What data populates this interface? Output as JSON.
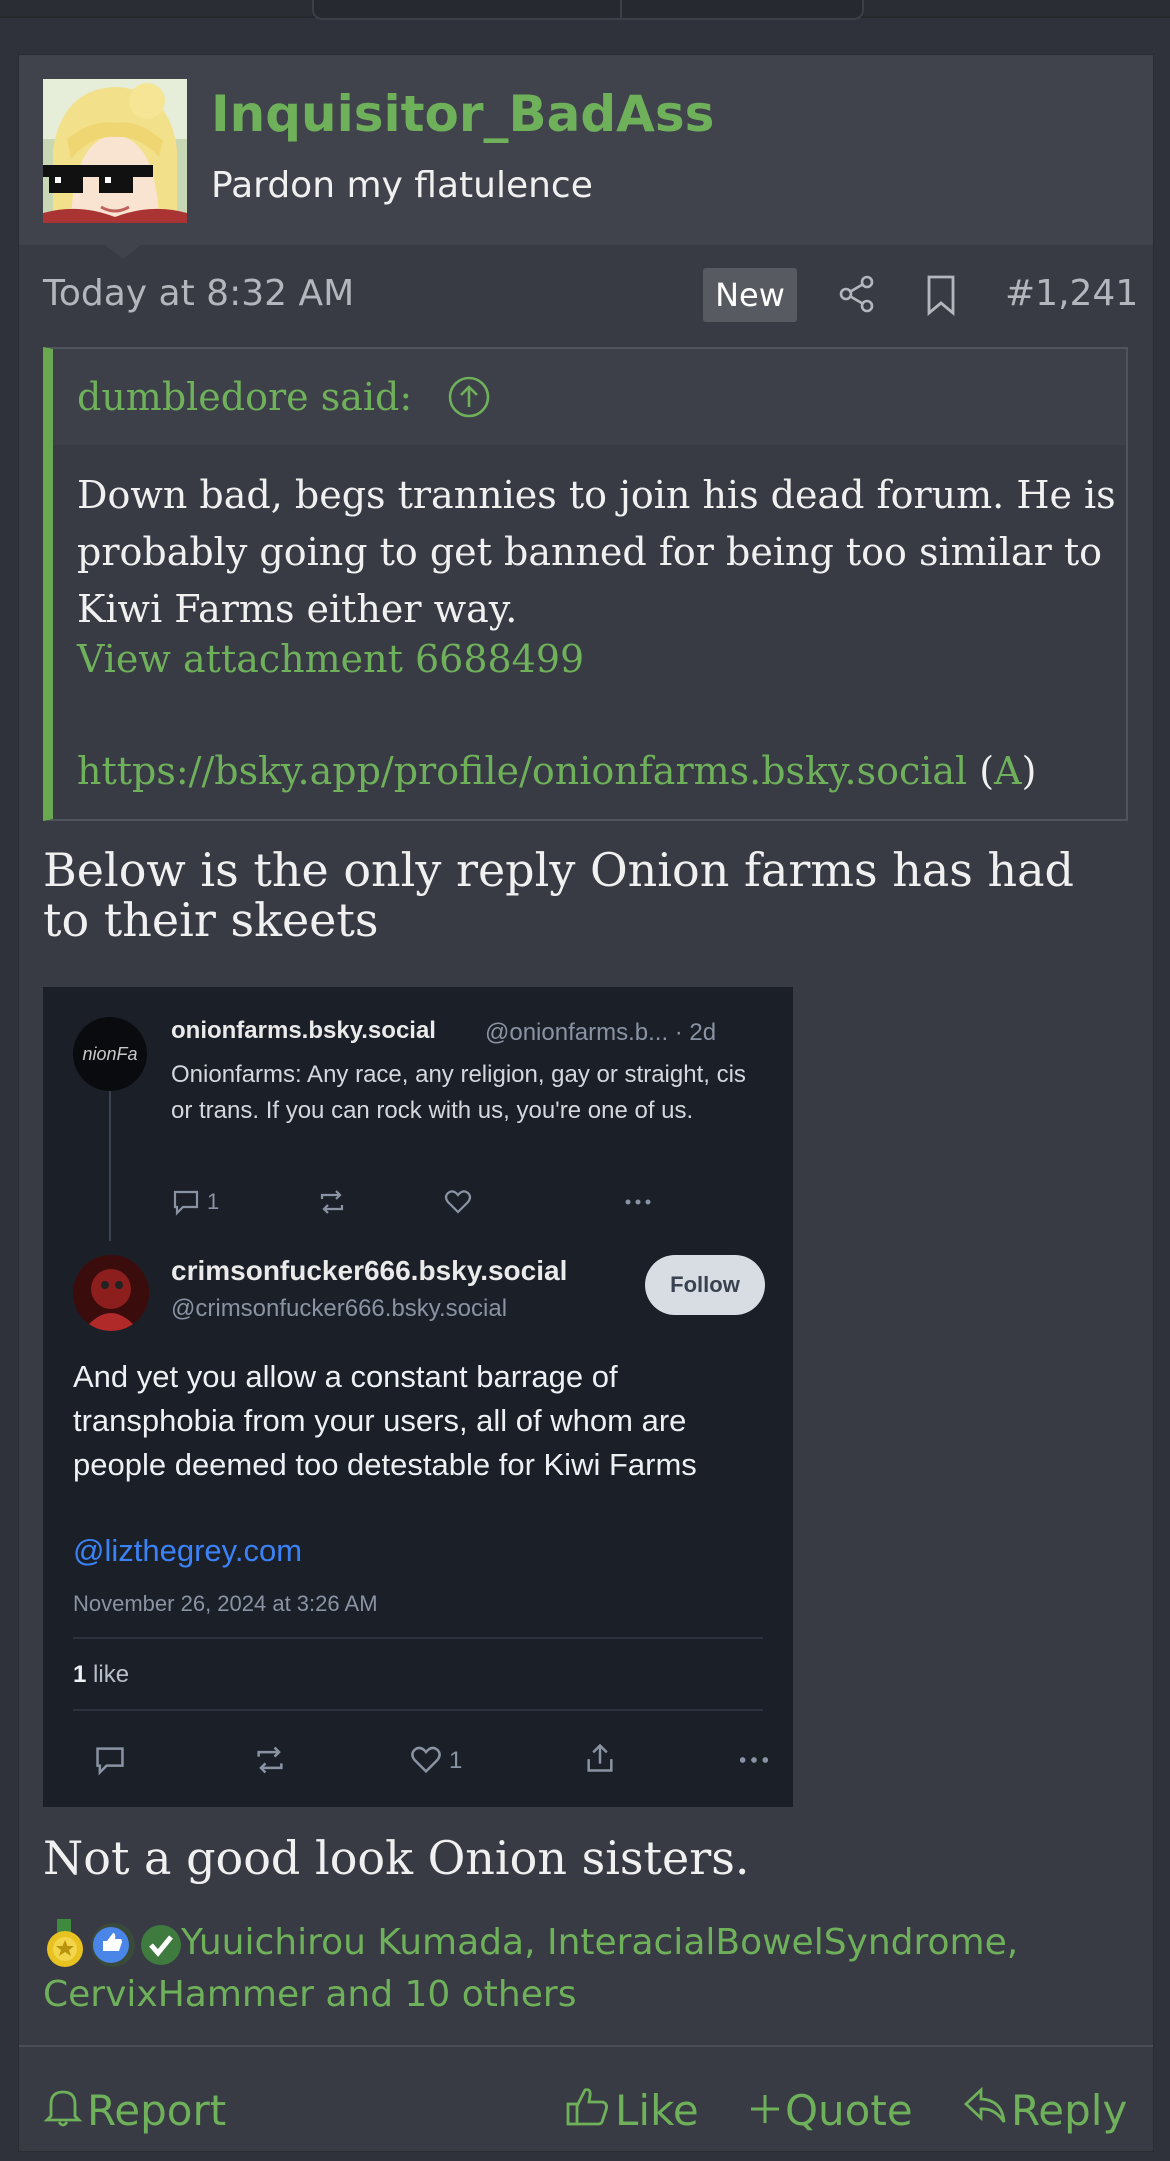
{
  "post": {
    "author": "Inquisitor_BadAss",
    "user_title": "Pardon my flatulence",
    "timestamp": "Today at 8:32 AM",
    "new_badge": "New",
    "post_number": "#1,241",
    "quote": {
      "author": "dumbledore said:",
      "body": "Down bad, begs trannies to join his dead forum. He is probably going to get banned for being too similar to Kiwi Farms either way.",
      "attachment_link": "View attachment 6688499",
      "url": "https://bsky.app/profile/onionfarms.bsky.social",
      "archive_open": "(",
      "archive_label": "A",
      "archive_close": ")"
    },
    "text_1": "Below is the only reply Onion farms has had to their skeets",
    "text_2": "Not a good look Onion sisters.",
    "reactions_text": "Yuuichirou Kumada, InteracialBowelSyndrome, CervixHammer and 10 others",
    "footer": {
      "report": "Report",
      "like": "Like",
      "quote": "Quote",
      "reply": "Reply"
    }
  },
  "embed": {
    "avatar1_text": "nionFa",
    "name1": "onionfarms.bsky.social",
    "handle1": "@onionfarms.b... · 2d",
    "text1": "Onionfarms: Any race, any religion, gay or straight, cis or trans. If you can rock with us, you're one of us.",
    "reply_count1": "1",
    "name2": "crimsonfucker666.bsky.social",
    "handle2": "@crimsonfucker666.bsky.social",
    "follow": "Follow",
    "text2": "And yet you allow a constant barrage of transphobia from your users, all of whom are people deemed too detestable for Kiwi Farms",
    "mention": "@lizthegrey.com",
    "date": "November 26, 2024 at 3:26 AM",
    "likes_num": "1",
    "likes_word": "like",
    "like_count2": "1"
  },
  "colors": {
    "accent": "#6fb05a",
    "background": "#2f323a",
    "post_bg": "#383b44",
    "header_bg": "#40434c",
    "embed_bg": "#1b1f28",
    "mention": "#3b82f6"
  },
  "icons": [
    "share-icon",
    "bookmark-icon",
    "arrow-up-circle-icon",
    "bell-icon",
    "thumbs-up-icon",
    "plus-icon",
    "reply-icon",
    "medal-icon",
    "like-reaction-icon",
    "checkmark-icon"
  ]
}
